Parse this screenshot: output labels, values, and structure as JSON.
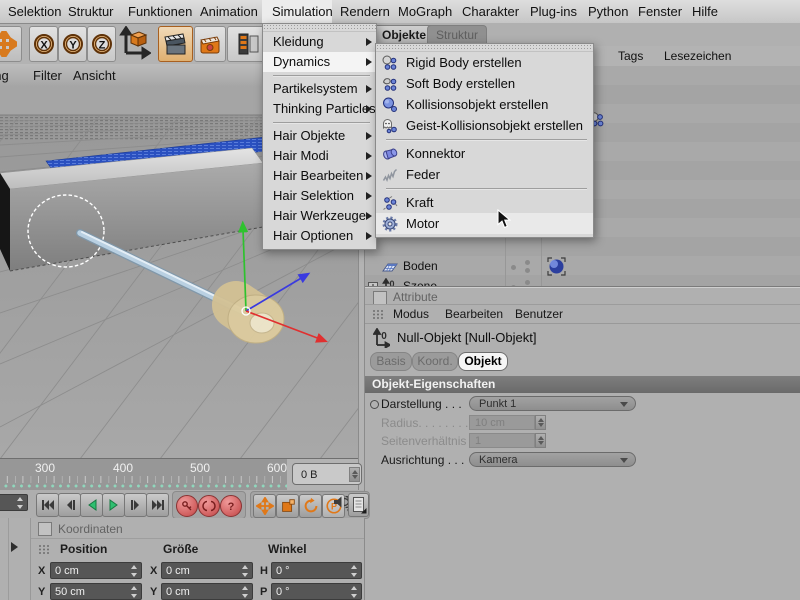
{
  "menubar": {
    "items": [
      "Selektion",
      "Struktur",
      "Funktionen",
      "Animation",
      "Simulation",
      "Rendern",
      "MoGraph",
      "Charakter",
      "Plug-ins",
      "Python",
      "Fenster",
      "Hilfe"
    ],
    "active_item": "Simulation"
  },
  "toolbar": {
    "axis_buttons": [
      "X",
      "Y",
      "Z"
    ],
    "icons": [
      "move-tool-icon",
      "axis-lock-icon",
      "render-view-icon",
      "render-settings-icon",
      "edit-render-settings-icon"
    ]
  },
  "viewport_menu": {
    "items": [
      "Darstellung",
      "Filter",
      "Ansicht"
    ]
  },
  "simulation_menu": {
    "items": [
      "Kleidung",
      "Dynamics",
      "Partikelsystem",
      "Thinking Particles",
      "Hair Objekte",
      "Hair Modi",
      "Hair Bearbeiten",
      "Hair Selektion",
      "Hair Werkzeuge",
      "Hair Optionen"
    ],
    "highlighted": "Dynamics"
  },
  "dynamics_submenu": {
    "items": [
      {
        "label": "Rigid Body erstellen",
        "icon": "rigid-body-icon"
      },
      {
        "label": "Soft Body erstellen",
        "icon": "soft-body-icon"
      },
      {
        "label": "Kollisionsobjekt erstellen",
        "icon": "collision-object-icon"
      },
      {
        "label": "Geist-Kollisionsobjekt erstellen",
        "icon": "ghost-collision-icon"
      },
      {
        "label": "Konnektor",
        "icon": "connector-icon"
      },
      {
        "label": "Feder",
        "icon": "spring-icon"
      },
      {
        "label": "Kraft",
        "icon": "force-icon"
      },
      {
        "label": "Motor",
        "icon": "motor-icon"
      }
    ],
    "highlighted": "Motor"
  },
  "object_manager": {
    "tabs": [
      "Objekte",
      "Struktur"
    ],
    "active_tab": "Objekte",
    "menu_items": [
      "Objekte",
      "Tags",
      "Lesezeichen"
    ],
    "objects": [
      {
        "name": "Boden",
        "icon": "floor-object-icon",
        "tag": "dynamics-body-tag-icon"
      },
      {
        "name": "Szene",
        "icon": "null-object-icon",
        "expandable": true
      }
    ]
  },
  "attribute_manager": {
    "title": "Attribute",
    "menu_items": [
      "Modus",
      "Bearbeiten",
      "Benutzer"
    ],
    "object_title": "Null-Objekt [Null-Objekt]",
    "tabs": [
      "Basis",
      "Koord.",
      "Objekt"
    ],
    "active_tab": "Objekt",
    "section_title": "Objekt-Eigenschaften",
    "properties": [
      {
        "label": "Darstellung . . .",
        "value": "Punkt 1",
        "control": "dropdown",
        "enabled": true
      },
      {
        "label": "Radius. . . . . . . .",
        "value": "10 cm",
        "control": "number",
        "enabled": false
      },
      {
        "label": "Seitenverhältnis",
        "value": "1",
        "control": "number",
        "enabled": false
      },
      {
        "label": "Ausrichtung . . .",
        "value": "Kamera",
        "control": "dropdown",
        "enabled": true
      }
    ]
  },
  "timeline": {
    "tick_labels": [
      "300",
      "400",
      "500",
      "600"
    ],
    "frame_value": "0 B"
  },
  "transport": {
    "nav_buttons": [
      "goto-start",
      "previous-frame",
      "play-backwards",
      "play-forwards",
      "next-frame",
      "goto-end"
    ],
    "record_buttons": [
      "record-keyframe",
      "autokeying",
      "keyframe-selection"
    ],
    "key_filter_buttons": [
      "record-position",
      "record-scale",
      "record-rotation",
      "record-parameter",
      "record-point-level",
      "sound",
      "keying-options"
    ]
  },
  "coordinate_manager": {
    "title": "Koordinaten",
    "columns": [
      "Position",
      "Größe",
      "Winkel"
    ],
    "rows": [
      {
        "pos_axis": "X",
        "pos_value": "0 cm",
        "size_axis": "X",
        "size_value": "0 cm",
        "angle_axis": "H",
        "angle_value": "0 °"
      },
      {
        "pos_axis": "Y",
        "pos_value": "50 cm",
        "size_axis": "Y",
        "size_value": "0 cm",
        "angle_axis": "P",
        "angle_value": "0 °"
      }
    ]
  },
  "colors": {
    "accent_orange": "#e07818",
    "play_green": "#2fbf70",
    "record_red": "#d05e5e",
    "selection_blue": "#2a50c0",
    "axis_green": "#2ec22e",
    "axis_red": "#e03030",
    "axis_blue": "#3a3ae0"
  }
}
